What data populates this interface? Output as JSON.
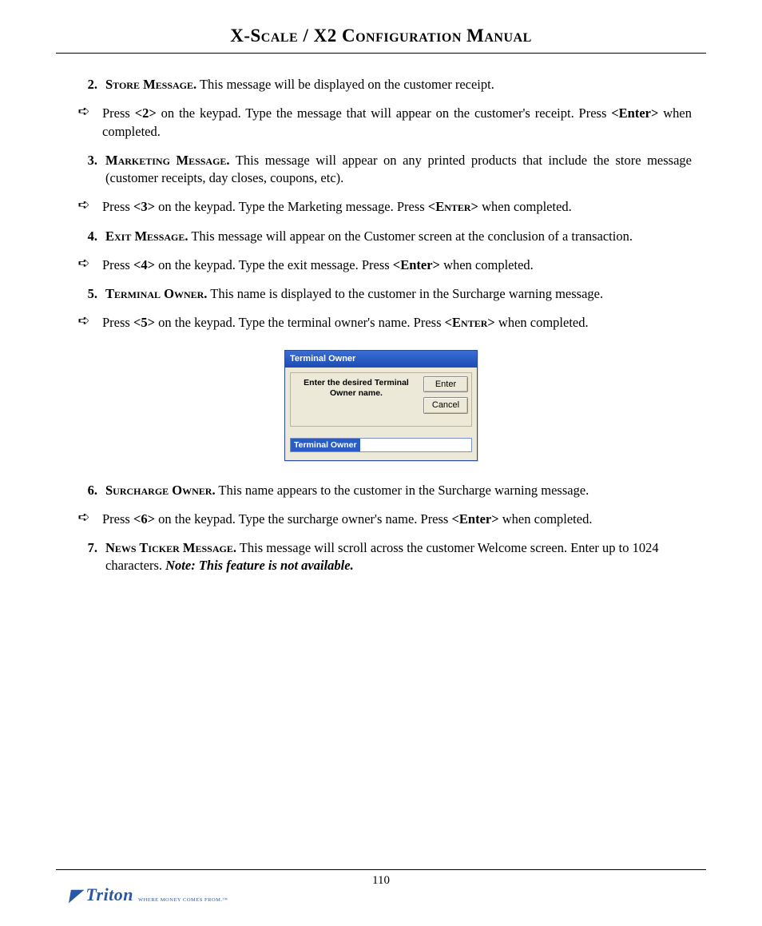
{
  "header": {
    "title": "X-Scale / X2 Configuration Manual"
  },
  "items": [
    {
      "num": "2.",
      "heading": "Store Message.",
      "text": "  This message will be displayed on the customer receipt.",
      "justify": false
    },
    {
      "arrow": true,
      "pre": "Press ",
      "key": "<2>",
      "post": " on the keypad.  Type the message that will appear on the customer's receipt.  Press ",
      "key2": "<Enter>",
      "post2": " when completed.",
      "justify": true
    },
    {
      "num": "3.",
      "heading": "Marketing Message.",
      "text": "  This message will appear on any printed products that include the store message (customer receipts, day closes, coupons, etc).",
      "justify": true
    },
    {
      "arrow": true,
      "pre": "Press ",
      "key": "<3>",
      "post": "  on the keypad.  Type the Marketing message.  Press ",
      "key2sc": "<Enter>",
      "post2": " when completed.",
      "justify": false
    },
    {
      "num": "4.",
      "heading": "Exit Message.",
      "text": "   This message will appear on the Customer screen at the conclusion of a transaction.",
      "justify": false
    },
    {
      "arrow": true,
      "pre": "Press ",
      "key": "<4>",
      "post": " on the keypad.  Type the exit message.  Press ",
      "key2": "<Enter>",
      "post2": " when completed.",
      "justify": false
    },
    {
      "num": "5.",
      "heading": "Terminal Owner.",
      "text": "  This name is displayed to the customer in the Surcharge warning message.",
      "justify": false
    },
    {
      "arrow": true,
      "pre": "Press ",
      "key": "<5>",
      "post": "  on the keypad.  Type the terminal owner's name.  Press ",
      "key2sc": "<Enter>",
      "post2": " when completed.",
      "justify": false
    }
  ],
  "dialog": {
    "title": "Terminal Owner",
    "message": "Enter the desired Terminal Owner name.",
    "enter": "Enter",
    "cancel": "Cancel",
    "field_label": "Terminal Owner"
  },
  "items2": [
    {
      "num": "6.",
      "heading": "Surcharge Owner.",
      "text": "  This name appears to the customer in the Surcharge warning message.",
      "justify": false
    },
    {
      "arrow": true,
      "pre": "Press ",
      "key": "<6>",
      "post": " on the keypad.  Type the surcharge owner's name.  Press ",
      "key2": "<Enter>",
      "post2": " when completed.",
      "justify": false
    },
    {
      "num": "7.",
      "heading": "News Ticker Message.",
      "text": "  This message will scroll across the customer Welcome screen.  Enter up to 1024 characters.   ",
      "note": "Note:  This feature is not available.",
      "justify": false
    }
  ],
  "footer": {
    "page_number": "110",
    "logo_text": "Triton",
    "logo_tag": "WHERE MONEY COMES FROM.™"
  }
}
